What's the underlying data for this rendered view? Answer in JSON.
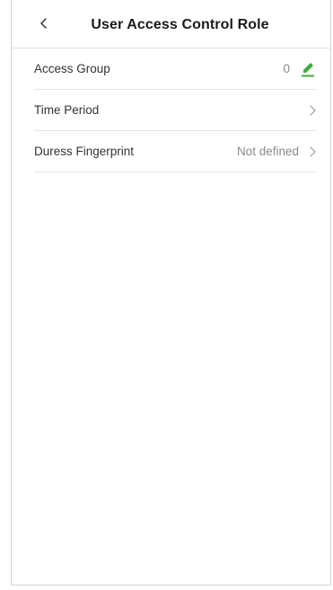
{
  "header": {
    "title": "User Access Control Role",
    "back_icon": "chevron-left-icon"
  },
  "rows": [
    {
      "label": "Access Group",
      "value": "0",
      "action_icon": "pencil-edit-icon",
      "accent_color": "#3cab3c"
    },
    {
      "label": "Time Period",
      "value": "",
      "action_icon": "chevron-right-icon"
    },
    {
      "label": "Duress Fingerprint",
      "value": "Not defined",
      "action_icon": "chevron-right-icon"
    }
  ]
}
